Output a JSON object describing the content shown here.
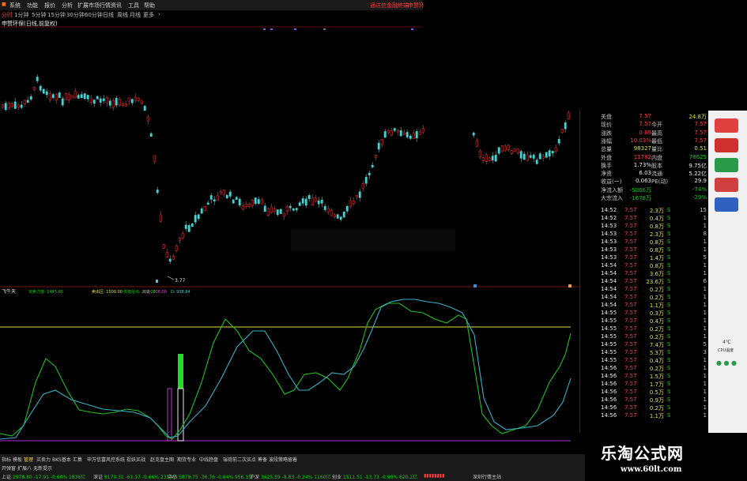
{
  "menu": {
    "left": [
      "系统",
      "功能",
      "报价",
      "分析",
      "扩展市场行情",
      "资讯",
      "工具",
      "帮助"
    ],
    "center": "通达信金融终端",
    "right": "申赞环保"
  },
  "periods": {
    "items": [
      "分时",
      "1分钟",
      "5分钟",
      "15分钟",
      "30分钟",
      "60分钟",
      "日线",
      "周线",
      "月线",
      "更多"
    ],
    "more_icon": "chevron-right-icon",
    "active_index": 0
  },
  "chart": {
    "title": "申赞环保(日线,前复权)",
    "low_label": "3.77"
  },
  "indicator": {
    "name": "飞牛天",
    "items": [
      {
        "label": "买卖力度:",
        "value": "1445.65",
        "color": "#00d600"
      },
      {
        "label": "卖出区:",
        "value": "1500.00",
        "color": "#e0e040"
      },
      {
        "label": "低吸信点:",
        "value": "200.00",
        "color": "#00d600"
      },
      {
        "label": "买进:",
        "value": "208.00",
        "color": "#e050e0"
      },
      {
        "label": "D:",
        "value": "938.84",
        "color": "#3ad0d0"
      }
    ]
  },
  "quote": {
    "rows": [
      {
        "l1": "关盘",
        "v1": "7.57",
        "l2": "",
        "v2": "24.8万",
        "c1": "#ff3a3a",
        "c2": "#e0e040"
      },
      {
        "l1": "现价",
        "v1": "7.57",
        "l2": "今开",
        "v2": "7.57",
        "c1": "#ff3a3a",
        "c2": "#ff3a3a"
      },
      {
        "l1": "涨跌",
        "v1": "0.69",
        "l2": "最高",
        "v2": "7.57",
        "c1": "#ff3a3a",
        "c2": "#ff3a3a"
      },
      {
        "l1": "涨幅",
        "v1": "10.03%",
        "l2": "最低",
        "v2": "7.57",
        "c1": "#ff3a3a",
        "c2": "#ff3a3a"
      },
      {
        "l1": "总量",
        "v1": "98327",
        "l2": "量比",
        "v2": "0.51",
        "c1": "#e0e040",
        "c2": "#e0e040"
      },
      {
        "l1": "外盘",
        "v1": "11782",
        "l2": "内盘",
        "v2": "78625",
        "c1": "#ff3a3a",
        "c2": "#00d600"
      },
      {
        "l1": "换手",
        "v1": "1.73%",
        "l2": "股本",
        "v2": "9.75亿",
        "c1": "#e8e8e8",
        "c2": "#e8e8e8"
      },
      {
        "l1": "净资",
        "v1": "6.03",
        "l2": "流通",
        "v2": "5.22亿",
        "c1": "#e8e8e8",
        "c2": "#e8e8e8"
      },
      {
        "l1": "收益(一)",
        "v1": "0.063",
        "l2": "PE(动)",
        "v2": "29.9",
        "c1": "#e8e8e8",
        "c2": "#e8e8e8"
      },
      {
        "l1": "净流入额",
        "v1": "-5066万",
        "l2": "",
        "v2": "-74%",
        "c1": "#00d600",
        "c2": "#00d600"
      },
      {
        "l1": "大宗流入",
        "v1": "-1678万",
        "l2": "",
        "v2": "-29%",
        "c1": "#00d600",
        "c2": "#00d600"
      }
    ],
    "trades": [
      {
        "t": "14:52",
        "p": "7.57",
        "v": "2.3万",
        "s": "S",
        "n": "15"
      },
      {
        "t": "14:52",
        "p": "7.57",
        "v": "0.4万",
        "s": "S",
        "n": "1"
      },
      {
        "t": "14:53",
        "p": "7.57",
        "v": "0.8万",
        "s": "S",
        "n": "1"
      },
      {
        "t": "14:53",
        "p": "7.57",
        "v": "2.3万",
        "s": "S",
        "n": "8"
      },
      {
        "t": "14:53",
        "p": "7.57",
        "v": "0.8万",
        "s": "S",
        "n": "1"
      },
      {
        "t": "14:53",
        "p": "7.57",
        "v": "0.8万",
        "s": "S",
        "n": "1"
      },
      {
        "t": "14:53",
        "p": "7.57",
        "v": "1.4万",
        "s": "S",
        "n": "5"
      },
      {
        "t": "14:54",
        "p": "7.57",
        "v": "0.8万",
        "s": "S",
        "n": "1"
      },
      {
        "t": "14:54",
        "p": "7.57",
        "v": "3.6万",
        "s": "S",
        "n": "1"
      },
      {
        "t": "14:54",
        "p": "7.57",
        "v": "23.6万",
        "s": "S",
        "n": "6"
      },
      {
        "t": "14:54",
        "p": "7.57",
        "v": "0.2万",
        "s": "S",
        "n": "1"
      },
      {
        "t": "14:54",
        "p": "7.57",
        "v": "0.2万",
        "s": "S",
        "n": "1"
      },
      {
        "t": "14:54",
        "p": "7.57",
        "v": "1.1万",
        "s": "S",
        "n": "1"
      },
      {
        "t": "14:55",
        "p": "7.57",
        "v": "0.3万",
        "s": "S",
        "n": "1"
      },
      {
        "t": "14:55",
        "p": "7.57",
        "v": "0.4万",
        "s": "S",
        "n": "1"
      },
      {
        "t": "14:55",
        "p": "7.57",
        "v": "0.2万",
        "s": "S",
        "n": "1"
      },
      {
        "t": "14:55",
        "p": "7.57",
        "v": "0.2万",
        "s": "S",
        "n": "1"
      },
      {
        "t": "14:55",
        "p": "7.57",
        "v": "7.4万",
        "s": "S",
        "n": "5"
      },
      {
        "t": "14:55",
        "p": "7.57",
        "v": "5.3万",
        "s": "S",
        "n": "3"
      },
      {
        "t": "14:55",
        "p": "7.57",
        "v": "0.4万",
        "s": "S",
        "n": "1"
      },
      {
        "t": "14:56",
        "p": "7.57",
        "v": "0.2万",
        "s": "S",
        "n": "1"
      },
      {
        "t": "14:56",
        "p": "7.57",
        "v": "1.5万",
        "s": "S",
        "n": "1"
      },
      {
        "t": "14:56",
        "p": "7.57",
        "v": "1.7万",
        "s": "S",
        "n": "1"
      },
      {
        "t": "14:56",
        "p": "7.57",
        "v": "0.5万",
        "s": "S",
        "n": "1"
      },
      {
        "t": "14:56",
        "p": "7.57",
        "v": "0.9万",
        "s": "S",
        "n": "1"
      },
      {
        "t": "14:56",
        "p": "7.57",
        "v": "0.2万",
        "s": "S",
        "n": "1"
      },
      {
        "t": "14:56",
        "p": "7.57",
        "v": "1.1万",
        "s": "S",
        "n": "1"
      }
    ]
  },
  "weather": {
    "temp": "4℃",
    "label": "CPU温度"
  },
  "tabs": {
    "items": [
      "指标",
      "模板",
      "管理",
      "买卖力",
      "BKS基本",
      "汇集",
      "申万信富风控系统",
      "捉妖买战",
      "赵克盘主图",
      "期货专业",
      "中线趋盘",
      "瑞荷前二次买点",
      "筹备",
      "波段策略留着"
    ],
    "active_index": 2
  },
  "bottombar": {
    "row2": [
      "开弹窗",
      "扩展八",
      "无新提示"
    ]
  },
  "indices": [
    {
      "name": "上证",
      "value": "2978.80",
      "chg": "-17.91",
      "pct": "-0.60%",
      "amt": "1836亿",
      "color": "#00d600"
    },
    {
      "name": "深证",
      "value": "9170.31",
      "chg": "-61.17",
      "pct": "-0.66%",
      "amt": "2319亿",
      "color": "#00d600"
    },
    {
      "name": "中小",
      "value": "5879.75",
      "chg": "-36.76",
      "pct": "-0.64%",
      "amt": "956.1亿",
      "color": "#00d600"
    },
    {
      "name": "沪深",
      "value": "3625.59",
      "chg": "-8.83",
      "pct": "-0.24%",
      "amt": "1160亿",
      "color": "#00d600"
    },
    {
      "name": "创业",
      "value": "1511.51",
      "chg": "-13.73",
      "pct": "-0.90%",
      "amt": "620.2亿",
      "color": "#00d600"
    }
  ],
  "status_right": "深圳行情主站",
  "watermark": {
    "line1": "乐淘公式网",
    "line2": "www.60lt.com"
  },
  "colors": {
    "up": "#ff3a3a",
    "down": "#00d600",
    "border": "#7a1010",
    "indicator_line": "#e0e040"
  }
}
